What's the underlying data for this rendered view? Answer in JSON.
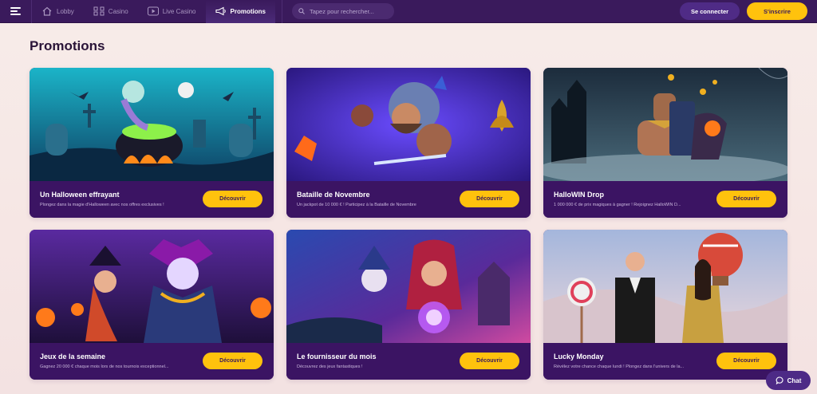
{
  "nav": {
    "items": [
      {
        "label": "Lobby",
        "icon": "home-icon"
      },
      {
        "label": "Casino",
        "icon": "grid-icon"
      },
      {
        "label": "Live Casino",
        "icon": "play-icon"
      },
      {
        "label": "Promotions",
        "icon": "megaphone-icon",
        "active": true
      }
    ]
  },
  "search": {
    "placeholder": "Tapez pour rechercher..."
  },
  "auth": {
    "login_label": "Se connecter",
    "signup_label": "S'inscrire"
  },
  "page": {
    "title": "Promotions"
  },
  "colors": {
    "accent": "#ffc20d",
    "topbar": "#3a1a5c",
    "card": "#3b1463"
  },
  "promotions": [
    {
      "title": "Un Halloween effrayant",
      "description": "Plongez dans la magie d'Halloween avec nos offres exclusives !",
      "cta": "Découvrir"
    },
    {
      "title": "Bataille de Novembre",
      "description": "Un jackpot de 10 000 € ! Participez à la Bataille de Novembre",
      "cta": "Découvrir"
    },
    {
      "title": "HalloWIN Drop",
      "description": "1 000 000 € de prix magiques à gagner ! Rejoignez HalloWIN D...",
      "cta": "Découvrir"
    },
    {
      "title": "Jeux de la semaine",
      "description": "Gagnez 20 000 € chaque mois lors de nos tournois exceptionnel...",
      "cta": "Découvrir"
    },
    {
      "title": "Le fournisseur du mois",
      "description": "Découvrez des jeux fantastiques !",
      "cta": "Découvrir"
    },
    {
      "title": "Lucky Monday",
      "description": "Révélez votre chance chaque lundi ! Plongez dans l'univers de la...",
      "cta": "Découvrir"
    }
  ],
  "chat": {
    "label": "Chat"
  }
}
